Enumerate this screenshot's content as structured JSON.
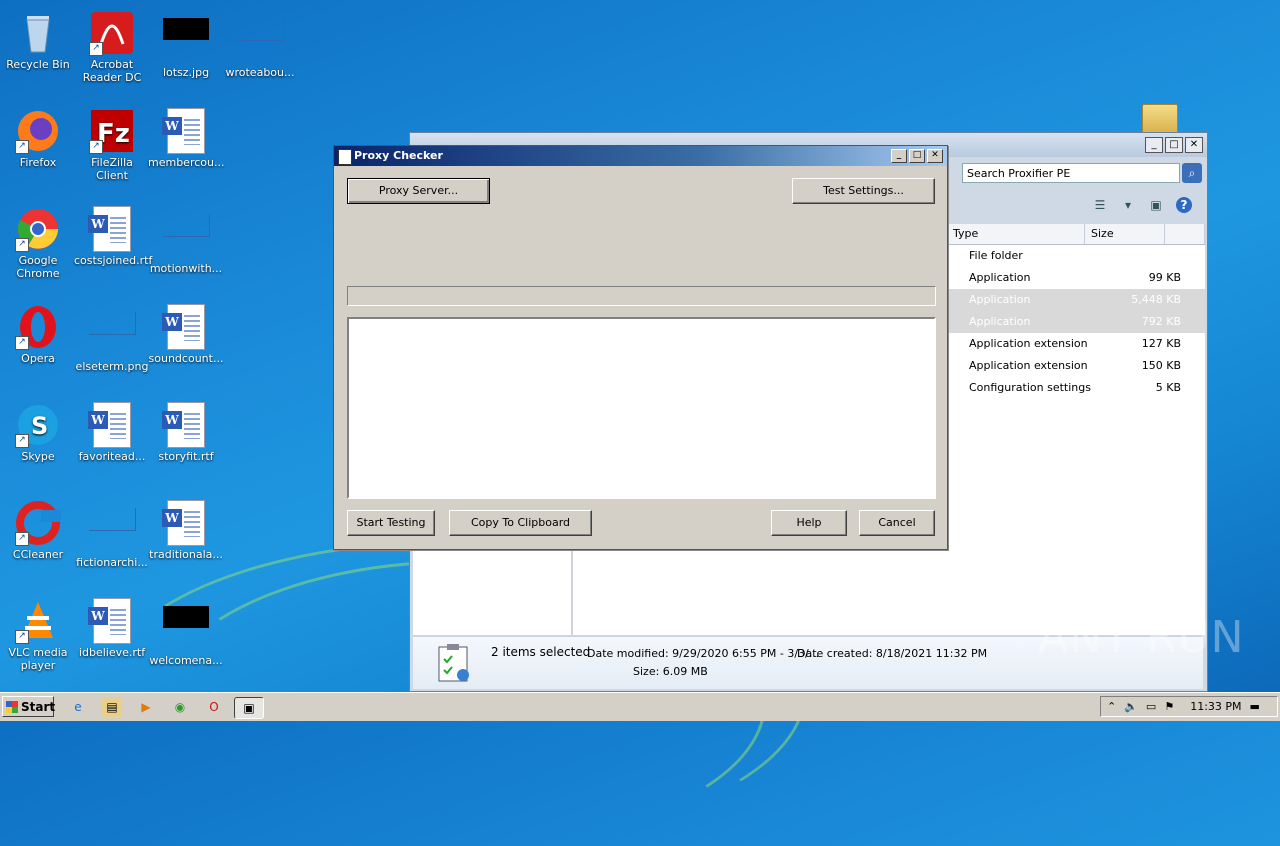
{
  "desktop": {
    "icons": [
      {
        "label": "Recycle Bin"
      },
      {
        "label": "Acrobat Reader DC"
      },
      {
        "label": "lotsz.jpg"
      },
      {
        "label": "wroteabou..."
      },
      {
        "label": "Firefox"
      },
      {
        "label": "FileZilla Client"
      },
      {
        "label": "membercou..."
      },
      {
        "label": "Google Chrome"
      },
      {
        "label": "costsjoined.rtf"
      },
      {
        "label": "motionwith..."
      },
      {
        "label": "Opera"
      },
      {
        "label": "elseterm.png"
      },
      {
        "label": "soundcount..."
      },
      {
        "label": "Skype"
      },
      {
        "label": "favoritead..."
      },
      {
        "label": "storyfit.rtf"
      },
      {
        "label": "CCleaner"
      },
      {
        "label": "fictionarchi..."
      },
      {
        "label": "traditionala..."
      },
      {
        "label": "VLC media player"
      },
      {
        "label": "idbelieve.rtf"
      },
      {
        "label": "welcomena..."
      }
    ]
  },
  "explorer": {
    "search_placeholder": "Search Proxifier PE",
    "columns": {
      "type": "Type",
      "size": "Size"
    },
    "files": [
      {
        "type": "File folder",
        "size": ""
      },
      {
        "type": "Application",
        "size": "99 KB"
      },
      {
        "type": "Application",
        "size": "5,448 KB"
      },
      {
        "type": "Application",
        "size": "792 KB"
      },
      {
        "type": "Application extension",
        "size": "127 KB"
      },
      {
        "type": "Application extension",
        "size": "150 KB"
      },
      {
        "type": "Configuration settings",
        "size": "5 KB"
      }
    ],
    "details": {
      "selected": "2 items selected",
      "modified": "Date modified: 9/29/2020 6:55 PM - 3/3/...",
      "created": "Date created: 8/18/2021 11:32 PM",
      "size": "Size: 6.09 MB"
    }
  },
  "dialog": {
    "title": "Proxy Checker",
    "proxy_server_btn": "Proxy Server...",
    "test_settings_btn": "Test Settings...",
    "start_testing_btn": "Start Testing",
    "copy_clipboard_btn": "Copy To Clipboard",
    "help_btn": "Help",
    "cancel_btn": "Cancel"
  },
  "taskbar": {
    "start_label": "Start",
    "clock": "11:33 PM"
  },
  "watermark": "ANY RUN",
  "colors": {
    "desktop_bg": "#1a8ad8",
    "dialog_title": "#0a246a",
    "dialog_bg": "#d4d0c8"
  }
}
